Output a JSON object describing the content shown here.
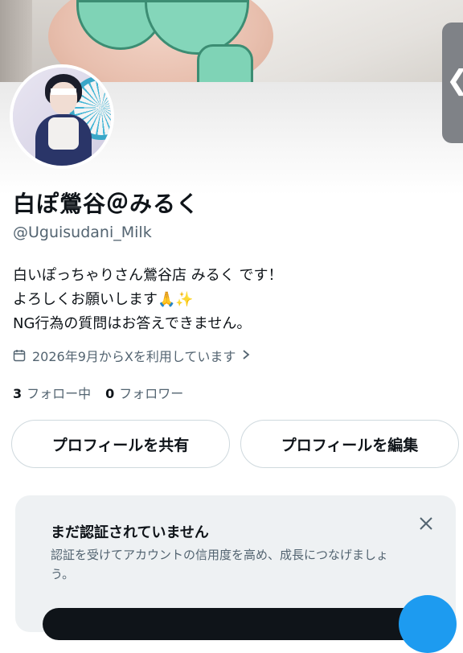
{
  "profile": {
    "display_name": "白ぽ鶯谷＠みるく",
    "handle": "@Uguisudani_Milk",
    "bio": "白いぽっちゃりさん鶯谷店 みるく です！\nよろしくお願いします🙏✨\nNG行為の質問はお答えできません。",
    "joined": "2026年9月からXを利用しています",
    "following_count": "3",
    "following_label": "フォロー中",
    "followers_count": "0",
    "followers_label": "フォロワー"
  },
  "actions": {
    "share_label": "プロフィールを共有",
    "edit_label": "プロフィールを編集"
  },
  "verify_card": {
    "title": "まだ認証されていません",
    "description": "認証を受けてアカウントの信用度を高め、成長につなげましょう。"
  },
  "icons": [
    "calendar-icon",
    "chevron-right-icon",
    "close-icon",
    "chevron-left-icon"
  ],
  "colors": {
    "accent": "#1d9bf0",
    "text_primary": "#0f1419",
    "text_secondary": "#536471",
    "border": "#cfd9de",
    "card_bg": "#eef1f3"
  }
}
